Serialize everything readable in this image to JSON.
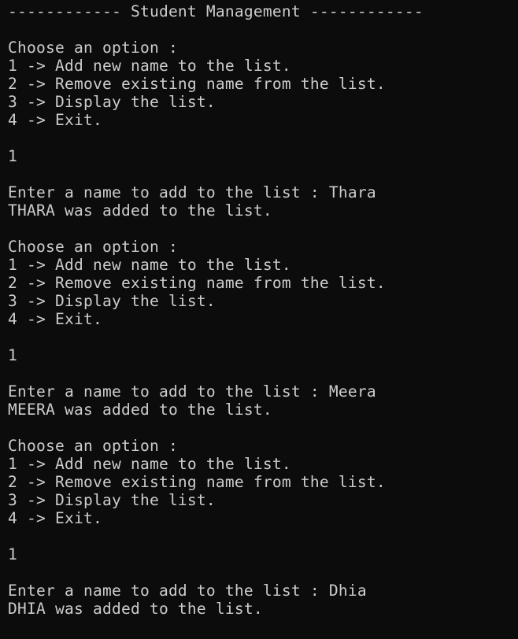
{
  "terminal": {
    "background": "#0c0c0c",
    "foreground": "#cccccc",
    "lines": [
      "------------ Student Management ------------",
      "",
      "Choose an option :",
      "1 -> Add new name to the list.",
      "2 -> Remove existing name from the list.",
      "3 -> Display the list.",
      "4 -> Exit.",
      "",
      "1",
      "",
      "Enter a name to add to the list : Thara",
      "THARA was added to the list.",
      "",
      "Choose an option :",
      "1 -> Add new name to the list.",
      "2 -> Remove existing name from the list.",
      "3 -> Display the list.",
      "4 -> Exit.",
      "",
      "1",
      "",
      "Enter a name to add to the list : Meera",
      "MEERA was added to the list.",
      "",
      "Choose an option :",
      "1 -> Add new name to the list.",
      "2 -> Remove existing name from the list.",
      "3 -> Display the list.",
      "4 -> Exit.",
      "",
      "1",
      "",
      "Enter a name to add to the list : Dhia",
      "DHIA was added to the list."
    ]
  }
}
